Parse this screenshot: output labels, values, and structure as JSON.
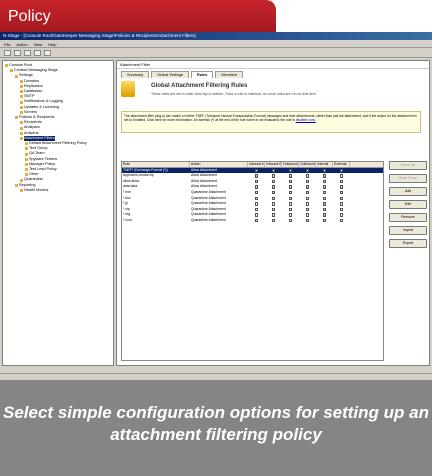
{
  "tab": {
    "label": "Policy"
  },
  "window": {
    "title": "N-Stage - [Console Root\\GateKeeper Messaging Stage\\Policies & Recipients\\Attachment Filters]"
  },
  "menu": [
    "File",
    "Action",
    "View",
    "Help"
  ],
  "tree": [
    "Console Root",
    "Content Messaging Stage",
    "Settings",
    "Domains",
    "Replication",
    "Databases",
    "SMTP",
    "Notifications & Logging",
    "Updates & Licensing",
    "Servers",
    "Policies & Recipients",
    "Recipients",
    "Antispam",
    "Antivirus",
    "Attachment Filters",
    "Default Attachment Filtering Policy",
    "Test Group",
    "QA Team",
    "Spyware Testers",
    "Manager Policy",
    "Test Lead Policy",
    "Other",
    "Quarantine",
    "Reporting",
    "Health Monitor"
  ],
  "panel": {
    "header": "Attachment Filter",
    "tabs": [
      "Summary",
      "Global Settings",
      "Rules",
      "Members"
    ],
    "hero_title": "Global Attachment Filtering Rules",
    "hero_sub": "These rules are set in order from top to bottom. Once a rule is matched, no more rules are run on that item.",
    "note": "The attachment filter plug-in can match on either TNEF (Transport Neutral Encapsulation Format) messages and their attachments, rather than just the attachment, and it the action for the attachment is set to Enabled. Click here for more information. An asterisk (*) at the end of the rule name is not evaluated; the rule is",
    "note_link": "disabled now."
  },
  "grid": {
    "headers": [
      "Rule",
      "Action",
      "Inbound Internal",
      "Inbound External",
      "Outbound Internal",
      "Outbound External",
      "Internal",
      "External"
    ],
    "rows": [
      {
        "name": "TNEF* (Exchange Format (*))",
        "action": "Allow Attachment",
        "checks": [
          true,
          true,
          true,
          true,
          true,
          true
        ]
      },
      {
        "name": "approved-vendor.zip",
        "action": "Allow Attachment",
        "checks": [
          true,
          false,
          true,
          false,
          true,
          false
        ]
      },
      {
        "name": "allow.allow",
        "action": "Allow Attachment",
        "checks": [
          true,
          true,
          true,
          true,
          true,
          true
        ]
      },
      {
        "name": "data.data",
        "action": "Allow Attachment",
        "checks": [
          true,
          true,
          true,
          true,
          true,
          true
        ]
      },
      {
        "name": "*.exe",
        "action": "Quarantine Attachment",
        "checks": [
          true,
          true,
          true,
          true,
          true,
          true
        ]
      },
      {
        "name": "*.doc",
        "action": "Quarantine Attachment",
        "checks": [
          false,
          false,
          false,
          false,
          true,
          false
        ]
      },
      {
        "name": "*.jp",
        "action": "Quarantine Attachment",
        "checks": [
          false,
          false,
          false,
          false,
          true,
          false
        ]
      },
      {
        "name": "*.zip",
        "action": "Quarantine Attachment",
        "checks": [
          false,
          false,
          false,
          false,
          true,
          false
        ]
      },
      {
        "name": "*.reg",
        "action": "Quarantine Attachment",
        "checks": [
          false,
          false,
          false,
          false,
          true,
          false
        ]
      },
      {
        "name": "*.com",
        "action": "Quarantine Attachment",
        "checks": [
          false,
          false,
          false,
          false,
          true,
          false
        ]
      }
    ]
  },
  "buttons": [
    "Move Up",
    "Move Down",
    "Add",
    "Edit",
    "Remove",
    "Import",
    "Export"
  ],
  "caption": "Select simple configuration options for setting up an attachment filtering policy"
}
